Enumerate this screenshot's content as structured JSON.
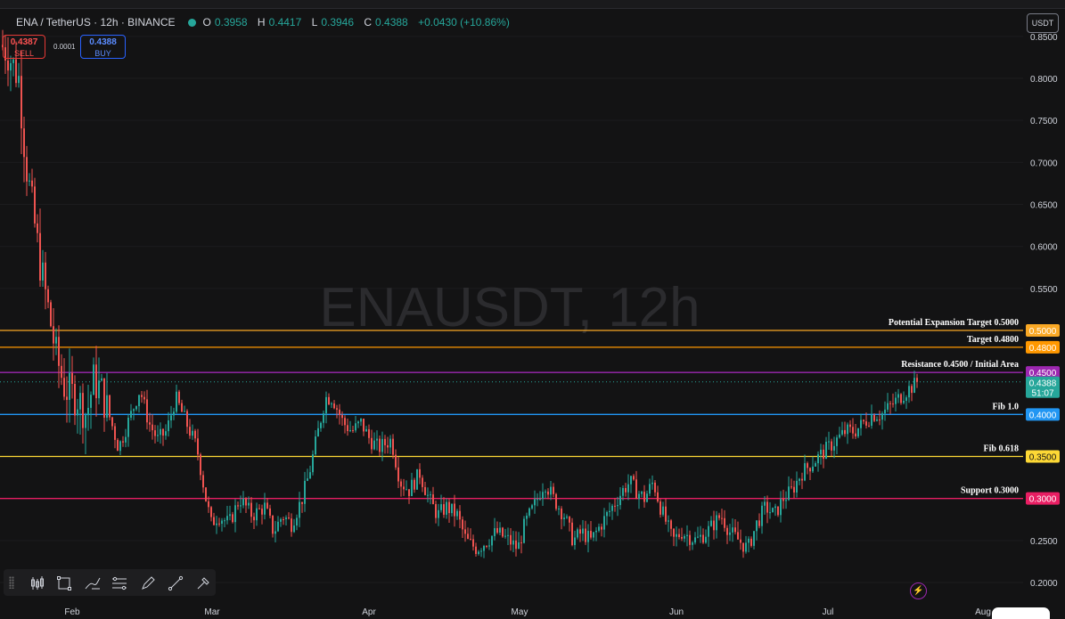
{
  "header": {
    "symbol": "ENA / TetherUS · 12h · BINANCE",
    "ohlc": [
      {
        "k": "O",
        "v": "0.3958"
      },
      {
        "k": "H",
        "v": "0.4417"
      },
      {
        "k": "L",
        "v": "0.3946"
      },
      {
        "k": "C",
        "v": "0.4388"
      }
    ],
    "change": "+0.0430 (+10.86%)"
  },
  "trade": {
    "sell_price": "0.4387",
    "sell_label": "SELL",
    "spread": "0.0001",
    "buy_price": "0.4388",
    "buy_label": "BUY"
  },
  "currency_button": "USDT",
  "toolbar_icons": [
    "candles-icon",
    "rectangle-icon",
    "brush-icon",
    "fib-icon",
    "pen-icon",
    "line-icon",
    "measure-icon"
  ],
  "chart_data": {
    "type": "candlestick",
    "watermark": "ENAUSDT, 12h",
    "y_ticks": [
      "0.8500",
      "0.8000",
      "0.7500",
      "0.7000",
      "0.6500",
      "0.6000",
      "0.5500",
      "0.2500",
      "0.2000"
    ],
    "ylim": [
      0.19,
      0.86
    ],
    "x_ticks": [
      "Feb",
      "Mar",
      "Apr",
      "May",
      "Jun",
      "Jul",
      "Aug"
    ],
    "levels": [
      {
        "label": "Potential Expansion Target 0.5000",
        "value": 0.5,
        "tag": "0.5000",
        "color": "#f9a825"
      },
      {
        "label": "Target 0.4800",
        "value": 0.48,
        "tag": "0.4800",
        "color": "#ff9800"
      },
      {
        "label": "Resistance 0.4500 / Initial Area",
        "value": 0.45,
        "tag": "0.4500",
        "color": "#9c27b0"
      },
      {
        "label": "Fib 1.0",
        "value": 0.4,
        "tag": "0.4000",
        "color": "#2196f3"
      },
      {
        "label": "Fib 0.618",
        "value": 0.35,
        "tag": "0.3500",
        "color": "#fdd835"
      },
      {
        "label": "Support 0.3000",
        "value": 0.3,
        "tag": "0.3000",
        "color": "#e91e63"
      }
    ],
    "current": {
      "price": "0.4388",
      "countdown": "51:07",
      "value": 0.4388
    },
    "up_color": "#26a69a",
    "down_color": "#ef5350",
    "path_anchors": [
      [
        0,
        0.84
      ],
      [
        8,
        0.83
      ],
      [
        12,
        0.82
      ],
      [
        20,
        0.8
      ],
      [
        28,
        0.7
      ],
      [
        36,
        0.64
      ],
      [
        44,
        0.58
      ],
      [
        54,
        0.52
      ],
      [
        62,
        0.47
      ],
      [
        72,
        0.43
      ],
      [
        86,
        0.42
      ],
      [
        96,
        0.4
      ],
      [
        104,
        0.44
      ],
      [
        112,
        0.43
      ],
      [
        124,
        0.39
      ],
      [
        132,
        0.36
      ],
      [
        146,
        0.4
      ],
      [
        156,
        0.43
      ],
      [
        166,
        0.39
      ],
      [
        176,
        0.37
      ],
      [
        186,
        0.38
      ],
      [
        196,
        0.42
      ],
      [
        208,
        0.39
      ],
      [
        220,
        0.36
      ],
      [
        230,
        0.3
      ],
      [
        236,
        0.27
      ],
      [
        244,
        0.28
      ],
      [
        256,
        0.27
      ],
      [
        268,
        0.3
      ],
      [
        282,
        0.28
      ],
      [
        296,
        0.29
      ],
      [
        306,
        0.26
      ],
      [
        316,
        0.28
      ],
      [
        326,
        0.27
      ],
      [
        338,
        0.3
      ],
      [
        346,
        0.33
      ],
      [
        356,
        0.38
      ],
      [
        364,
        0.42
      ],
      [
        372,
        0.42
      ],
      [
        384,
        0.39
      ],
      [
        394,
        0.38
      ],
      [
        404,
        0.39
      ],
      [
        414,
        0.37
      ],
      [
        424,
        0.36
      ],
      [
        438,
        0.37
      ],
      [
        448,
        0.32
      ],
      [
        458,
        0.31
      ],
      [
        470,
        0.33
      ],
      [
        480,
        0.3
      ],
      [
        490,
        0.28
      ],
      [
        500,
        0.29
      ],
      [
        512,
        0.28
      ],
      [
        522,
        0.25
      ],
      [
        534,
        0.24
      ],
      [
        546,
        0.25
      ],
      [
        556,
        0.26
      ],
      [
        570,
        0.25
      ],
      [
        580,
        0.24
      ],
      [
        588,
        0.27
      ],
      [
        598,
        0.29
      ],
      [
        610,
        0.32
      ],
      [
        620,
        0.3
      ],
      [
        632,
        0.28
      ],
      [
        642,
        0.25
      ],
      [
        652,
        0.26
      ],
      [
        662,
        0.25
      ],
      [
        674,
        0.27
      ],
      [
        686,
        0.29
      ],
      [
        698,
        0.31
      ],
      [
        706,
        0.32
      ],
      [
        712,
        0.31
      ],
      [
        722,
        0.3
      ],
      [
        732,
        0.32
      ],
      [
        740,
        0.29
      ],
      [
        754,
        0.25
      ],
      [
        764,
        0.26
      ],
      [
        780,
        0.25
      ],
      [
        792,
        0.26
      ],
      [
        800,
        0.27
      ],
      [
        808,
        0.28
      ],
      [
        818,
        0.26
      ],
      [
        828,
        0.25
      ],
      [
        838,
        0.24
      ],
      [
        848,
        0.27
      ],
      [
        858,
        0.29
      ],
      [
        868,
        0.28
      ],
      [
        878,
        0.3
      ],
      [
        888,
        0.31
      ],
      [
        898,
        0.33
      ],
      [
        908,
        0.34
      ],
      [
        918,
        0.35
      ],
      [
        928,
        0.36
      ],
      [
        938,
        0.37
      ],
      [
        948,
        0.38
      ],
      [
        958,
        0.38
      ],
      [
        968,
        0.39
      ],
      [
        978,
        0.4
      ],
      [
        988,
        0.4
      ],
      [
        998,
        0.41
      ],
      [
        1008,
        0.42
      ],
      [
        1018,
        0.43
      ],
      [
        1030,
        0.4388
      ]
    ]
  }
}
